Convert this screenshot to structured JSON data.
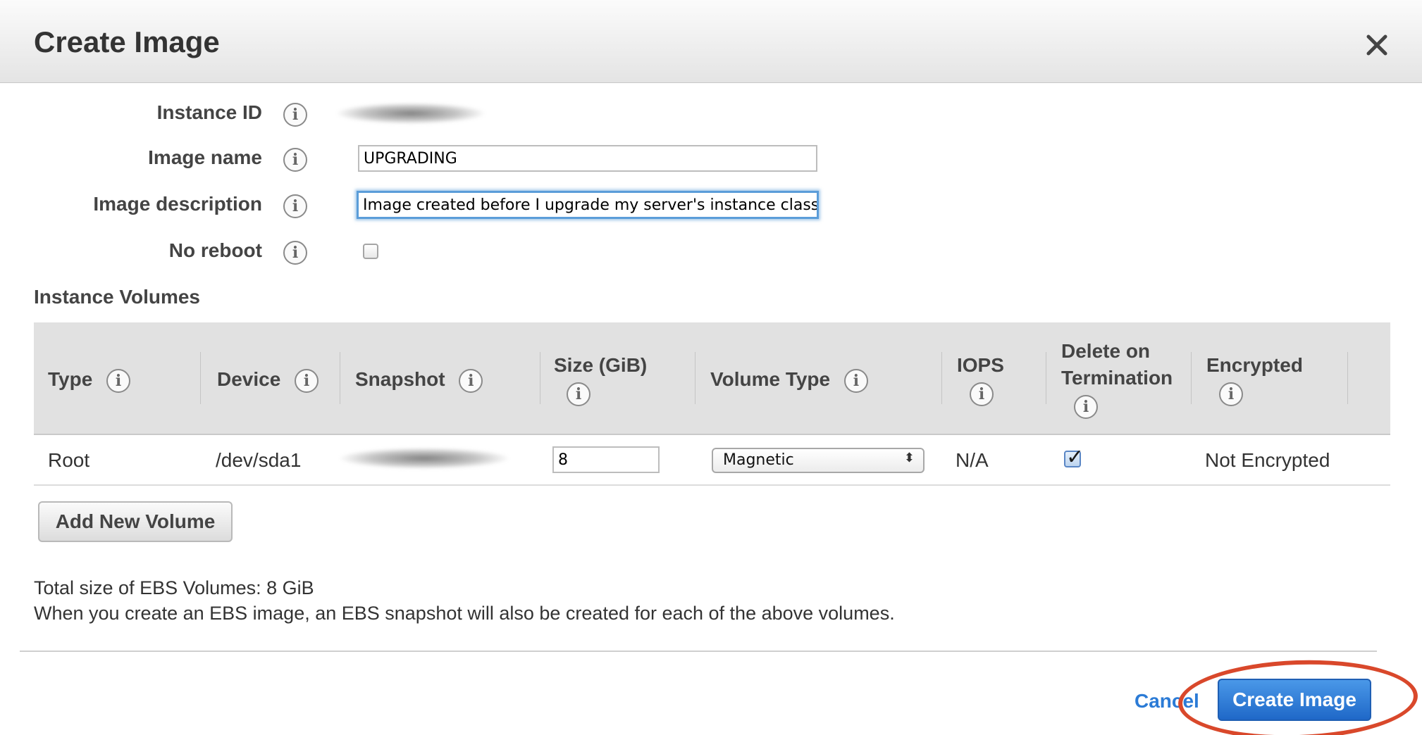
{
  "dialog": {
    "title": "Create Image",
    "close_icon": "close-icon"
  },
  "form": {
    "instance_id": {
      "label": "Instance ID",
      "value_redacted": true
    },
    "image_name": {
      "label": "Image name",
      "value": "UPGRADING"
    },
    "image_description": {
      "label": "Image description",
      "value": "Image created before I upgrade my server's instance class"
    },
    "no_reboot": {
      "label": "No reboot",
      "checked": false
    }
  },
  "volumes": {
    "section_title": "Instance Volumes",
    "columns": [
      "Type",
      "Device",
      "Snapshot",
      "Size (GiB)",
      "Volume Type",
      "IOPS",
      "Delete on Termination",
      "Encrypted"
    ],
    "header_lines": {
      "delete_line1": "Delete on",
      "delete_line2": "Termination"
    },
    "rows": [
      {
        "type": "Root",
        "device": "/dev/sda1",
        "snapshot_redacted": true,
        "size": "8",
        "volume_type": "Magnetic",
        "iops": "N/A",
        "delete_on_termination": true,
        "encrypted": "Not Encrypted"
      }
    ],
    "add_button": "Add New Volume"
  },
  "summary": {
    "total_size": "Total size of EBS Volumes: 8 GiB",
    "note": "When you create an EBS image, an EBS snapshot will also be created for each of the above volumes."
  },
  "footer": {
    "cancel": "Cancel",
    "create": "Create Image",
    "highlight_color": "#d9482b"
  },
  "colors": {
    "primary_button": "#2f7fd9",
    "link": "#2b7bd6",
    "header_bg": "#eeeeee"
  }
}
